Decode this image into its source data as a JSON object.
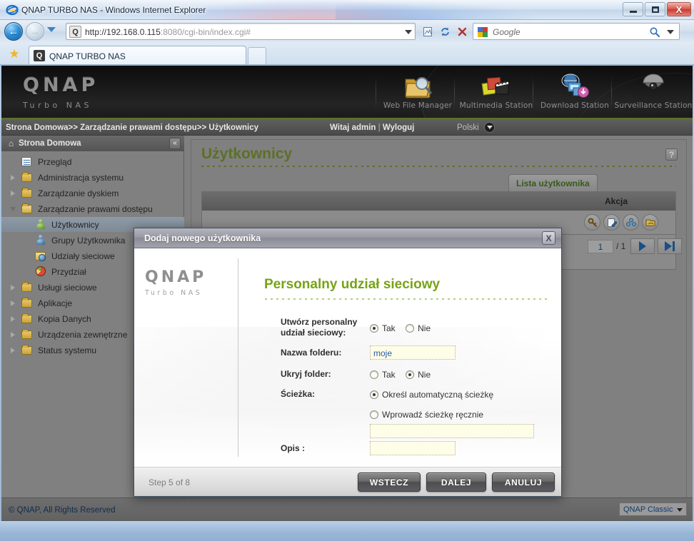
{
  "browser": {
    "window_title": "QNAP TURBO NAS - Windows Internet Explorer",
    "minimize_label": "Minimize",
    "maximize_label": "Maximize",
    "close_label": "X",
    "address_url_main": "http://192.168.0.115",
    "address_url_port": ":8080",
    "address_url_path": "/cgi-bin/index.cgi#",
    "favicon_letter": "Q",
    "search_placeholder": "Google",
    "tab_label": "QNAP TURBO NAS",
    "tab_icon_letter": "Q",
    "new_tab_label": "",
    "back_icon": "back-arrow-icon",
    "forward_icon": "forward-arrow-icon",
    "compat_icon": "compatibility-view-icon",
    "refresh_icon": "refresh-icon",
    "stop_icon": "stop-icon",
    "favorites_icon": "star-icon"
  },
  "banner": {
    "logo_main": "QNAP",
    "logo_sub": "Turbo NAS",
    "apps": [
      {
        "label": "Web File Manager",
        "icon": "folder-search-icon"
      },
      {
        "label": "Multimedia Station",
        "icon": "photos-clapperboard-icon"
      },
      {
        "label": "Download Station",
        "icon": "download-monitor-icon"
      },
      {
        "label": "Surveillance Station",
        "icon": "dome-camera-icon"
      }
    ],
    "accent_color": "#5d7026"
  },
  "crumbbar": {
    "breadcrumb": "Strona Domowa>> Zarządzanie prawami dostępu>> Użytkownicy",
    "welcome": "Witaj admin",
    "separator": "|",
    "logout": "Wyloguj",
    "language": "Polski"
  },
  "sidebar": {
    "header": "Strona Domowa",
    "header_icon": "home-icon",
    "collapse_icon": "collapse-left-icon",
    "items": [
      {
        "label": "Przegląd",
        "icon": "page-icon",
        "level": 0,
        "twisty": "none",
        "selected": false
      },
      {
        "label": "Administracja systemu",
        "icon": "folder-icon",
        "level": 0,
        "twisty": "closed",
        "selected": false
      },
      {
        "label": "Zarządzanie dyskiem",
        "icon": "folder-icon",
        "level": 0,
        "twisty": "closed",
        "selected": false
      },
      {
        "label": "Zarządzanie prawami dostępu",
        "icon": "folder-open-icon",
        "level": 0,
        "twisty": "open",
        "selected": false
      },
      {
        "label": "Użytkownicy",
        "icon": "user-green-icon",
        "level": 1,
        "twisty": "none",
        "selected": true
      },
      {
        "label": "Grupy Użytkownika",
        "icon": "user-group-blue-icon",
        "level": 1,
        "twisty": "none",
        "selected": false
      },
      {
        "label": "Udziały sieciowe",
        "icon": "share-folder-icon",
        "level": 1,
        "twisty": "none",
        "selected": false
      },
      {
        "label": "Przydział",
        "icon": "quota-pie-icon",
        "level": 1,
        "twisty": "none",
        "selected": false
      },
      {
        "label": "Usługi sieciowe",
        "icon": "folder-icon",
        "level": 0,
        "twisty": "closed",
        "selected": false
      },
      {
        "label": "Aplikacje",
        "icon": "folder-icon",
        "level": 0,
        "twisty": "closed",
        "selected": false
      },
      {
        "label": "Kopia Danych",
        "icon": "folder-icon",
        "level": 0,
        "twisty": "closed",
        "selected": false
      },
      {
        "label": "Urządzenia zewnętrzne",
        "icon": "folder-icon",
        "level": 0,
        "twisty": "closed",
        "selected": false
      },
      {
        "label": "Status systemu",
        "icon": "folder-icon",
        "level": 0,
        "twisty": "closed",
        "selected": false
      }
    ]
  },
  "content": {
    "page_title": "Użytkownicy",
    "help_label": "?",
    "tab_label": "Lista użytkownika",
    "table_header_action": "Akcja",
    "action_icons": [
      {
        "name": "change-password-icon",
        "glyph": "key"
      },
      {
        "name": "edit-user-icon",
        "glyph": "pencil"
      },
      {
        "name": "edit-groups-icon",
        "glyph": "group"
      },
      {
        "name": "edit-shared-folders-icon",
        "glyph": "folder-hand"
      }
    ],
    "pager": {
      "page_value": "1",
      "page_total": "/ 1",
      "next_icon": "next-page-icon",
      "last_icon": "last-page-icon"
    }
  },
  "statusbar": {
    "copyright": "© QNAP, All Rights Reserved",
    "theme_selected": "QNAP Classic",
    "theme_caret": "chevron-down-icon"
  },
  "dialog": {
    "title": "Dodaj nowego użytkownika",
    "close_label": "X",
    "logo_main": "QNAP",
    "logo_sub": "Turbo NAS",
    "heading": "Personalny udział sieciowy",
    "heading_color": "#76a316",
    "fields": {
      "create_share_label_line1": "Utwórz personalny",
      "create_share_label_line2": "udział sieciowy:",
      "create_share_yes": "Tak",
      "create_share_no": "Nie",
      "create_share_value": "Tak",
      "folder_name_label": "Nazwa folderu:",
      "folder_name_value": "moje",
      "hide_folder_label": "Ukryj folder:",
      "hide_folder_yes": "Tak",
      "hide_folder_no": "Nie",
      "hide_folder_value": "Nie",
      "path_label": "Ścieżka:",
      "path_auto": "Określ automatyczną ścieżkę",
      "path_manual": "Wprowadź ścieżkę ręcznie",
      "path_value": "Określ automatyczną ścieżkę",
      "path_manual_value": "",
      "description_label": "Opis :",
      "description_value": ""
    },
    "footer": {
      "step_text": "Step 5 of 8",
      "back_button": "WSTECZ",
      "next_button": "DALEJ",
      "cancel_button": "ANULUJ"
    }
  }
}
